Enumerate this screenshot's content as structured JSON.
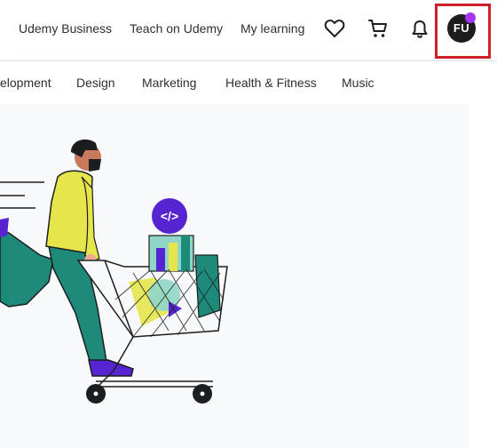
{
  "header": {
    "nav": {
      "udemy_business": "Udemy Business",
      "teach": "Teach on Udemy",
      "my_learning": "My learning"
    },
    "icons": {
      "wishlist": "heart-icon",
      "cart": "cart-icon",
      "notifications": "bell-icon"
    },
    "avatar": {
      "initials": "FU",
      "dot_color": "#a435f0"
    }
  },
  "categories": [
    "elopment",
    "Design",
    "Marketing",
    "Health & Fitness",
    "Music"
  ],
  "colors": {
    "highlight": "#d01f27",
    "hero_bg": "#f7f9fa",
    "accent_purple": "#5624d0",
    "teal": "#1e8a7a",
    "yellow": "#e6e64c"
  },
  "hero": {
    "code_badge": "</>"
  }
}
